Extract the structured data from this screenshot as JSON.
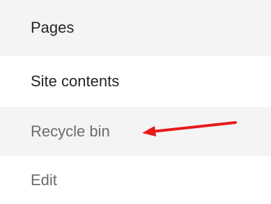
{
  "nav": {
    "items": [
      {
        "label": "Pages"
      },
      {
        "label": "Site contents"
      },
      {
        "label": "Recycle bin"
      },
      {
        "label": "Edit"
      }
    ]
  },
  "annotation": {
    "arrow_color": "#e8191a",
    "points_to": "Recycle bin"
  }
}
